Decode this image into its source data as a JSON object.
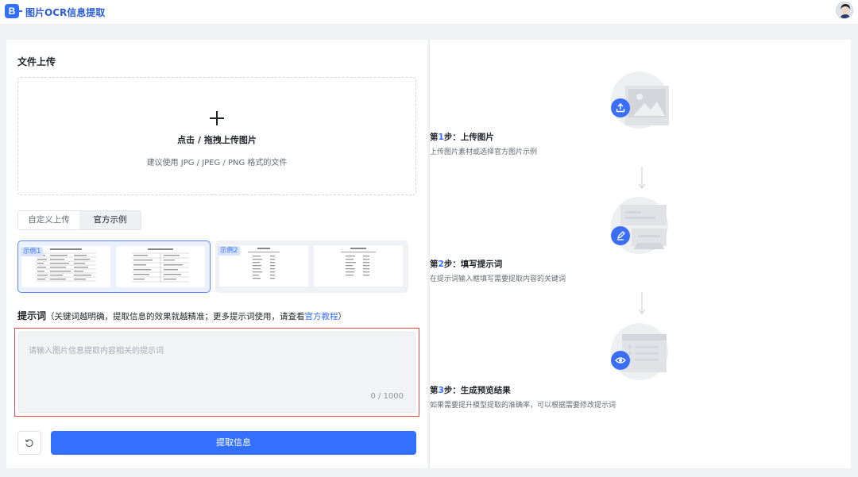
{
  "header": {
    "logo_text": "B",
    "app_title": "图片OCR信息提取"
  },
  "upload": {
    "section_title": "文件上传",
    "title": "点击 / 拖拽上传图片",
    "hint": "建议使用 JPG / JPEG / PNG 格式的文件"
  },
  "tabs": [
    {
      "label": "自定义上传",
      "active": false
    },
    {
      "label": "官方示例",
      "active": true
    }
  ],
  "examples": [
    {
      "badge": "示例1",
      "selected": true
    },
    {
      "badge": "示例2",
      "selected": false
    }
  ],
  "prompt": {
    "label": "提示词",
    "hint_prefix": "（关键词越明确，提取信息的效果就越精准；更多提示词使用，请查看",
    "link": "官方教程",
    "hint_suffix": "）",
    "placeholder": "请输入图片信息提取内容相关的提示词",
    "value": "",
    "counter": "0 / 1000"
  },
  "actions": {
    "extract_label": "提取信息"
  },
  "steps": [
    {
      "prefix": "第",
      "num": "1",
      "suffix": "步：上传图片",
      "desc": "上传图片素材或选择官方图片示例",
      "icon": "upload-icon"
    },
    {
      "prefix": "第",
      "num": "2",
      "suffix": "步：填写提示词",
      "desc": "在提示词输入框填写需要提取内容的关键词",
      "icon": "edit-icon"
    },
    {
      "prefix": "第",
      "num": "3",
      "suffix": "步：生成预览结果",
      "desc": "如果需要提升模型提取的准确率，可以根据需要修改提示词",
      "icon": "eye-icon"
    }
  ],
  "colors": {
    "accent": "#3370ff",
    "highlight_border": "#e94b4b"
  }
}
